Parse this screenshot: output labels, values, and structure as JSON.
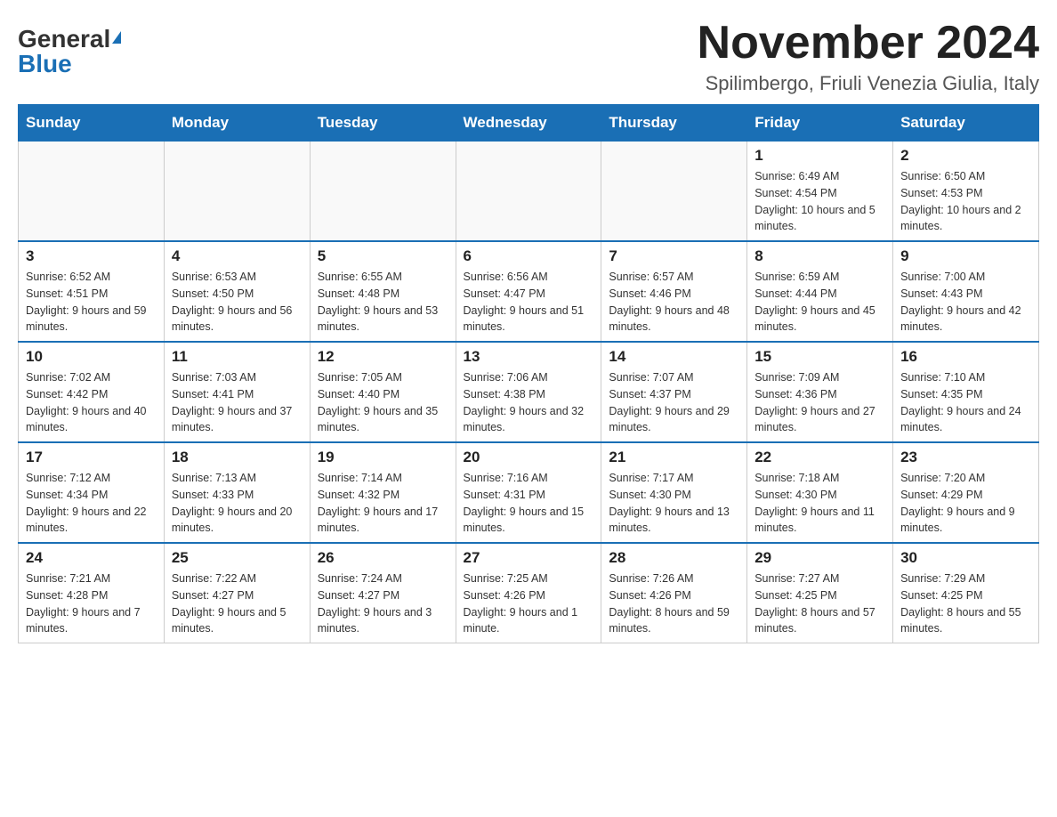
{
  "header": {
    "logo_general": "General",
    "logo_blue": "Blue",
    "month_title": "November 2024",
    "subtitle": "Spilimbergo, Friuli Venezia Giulia, Italy"
  },
  "days_of_week": [
    "Sunday",
    "Monday",
    "Tuesday",
    "Wednesday",
    "Thursday",
    "Friday",
    "Saturday"
  ],
  "weeks": [
    [
      {
        "day": "",
        "info": ""
      },
      {
        "day": "",
        "info": ""
      },
      {
        "day": "",
        "info": ""
      },
      {
        "day": "",
        "info": ""
      },
      {
        "day": "",
        "info": ""
      },
      {
        "day": "1",
        "info": "Sunrise: 6:49 AM\nSunset: 4:54 PM\nDaylight: 10 hours and 5 minutes."
      },
      {
        "day": "2",
        "info": "Sunrise: 6:50 AM\nSunset: 4:53 PM\nDaylight: 10 hours and 2 minutes."
      }
    ],
    [
      {
        "day": "3",
        "info": "Sunrise: 6:52 AM\nSunset: 4:51 PM\nDaylight: 9 hours and 59 minutes."
      },
      {
        "day": "4",
        "info": "Sunrise: 6:53 AM\nSunset: 4:50 PM\nDaylight: 9 hours and 56 minutes."
      },
      {
        "day": "5",
        "info": "Sunrise: 6:55 AM\nSunset: 4:48 PM\nDaylight: 9 hours and 53 minutes."
      },
      {
        "day": "6",
        "info": "Sunrise: 6:56 AM\nSunset: 4:47 PM\nDaylight: 9 hours and 51 minutes."
      },
      {
        "day": "7",
        "info": "Sunrise: 6:57 AM\nSunset: 4:46 PM\nDaylight: 9 hours and 48 minutes."
      },
      {
        "day": "8",
        "info": "Sunrise: 6:59 AM\nSunset: 4:44 PM\nDaylight: 9 hours and 45 minutes."
      },
      {
        "day": "9",
        "info": "Sunrise: 7:00 AM\nSunset: 4:43 PM\nDaylight: 9 hours and 42 minutes."
      }
    ],
    [
      {
        "day": "10",
        "info": "Sunrise: 7:02 AM\nSunset: 4:42 PM\nDaylight: 9 hours and 40 minutes."
      },
      {
        "day": "11",
        "info": "Sunrise: 7:03 AM\nSunset: 4:41 PM\nDaylight: 9 hours and 37 minutes."
      },
      {
        "day": "12",
        "info": "Sunrise: 7:05 AM\nSunset: 4:40 PM\nDaylight: 9 hours and 35 minutes."
      },
      {
        "day": "13",
        "info": "Sunrise: 7:06 AM\nSunset: 4:38 PM\nDaylight: 9 hours and 32 minutes."
      },
      {
        "day": "14",
        "info": "Sunrise: 7:07 AM\nSunset: 4:37 PM\nDaylight: 9 hours and 29 minutes."
      },
      {
        "day": "15",
        "info": "Sunrise: 7:09 AM\nSunset: 4:36 PM\nDaylight: 9 hours and 27 minutes."
      },
      {
        "day": "16",
        "info": "Sunrise: 7:10 AM\nSunset: 4:35 PM\nDaylight: 9 hours and 24 minutes."
      }
    ],
    [
      {
        "day": "17",
        "info": "Sunrise: 7:12 AM\nSunset: 4:34 PM\nDaylight: 9 hours and 22 minutes."
      },
      {
        "day": "18",
        "info": "Sunrise: 7:13 AM\nSunset: 4:33 PM\nDaylight: 9 hours and 20 minutes."
      },
      {
        "day": "19",
        "info": "Sunrise: 7:14 AM\nSunset: 4:32 PM\nDaylight: 9 hours and 17 minutes."
      },
      {
        "day": "20",
        "info": "Sunrise: 7:16 AM\nSunset: 4:31 PM\nDaylight: 9 hours and 15 minutes."
      },
      {
        "day": "21",
        "info": "Sunrise: 7:17 AM\nSunset: 4:30 PM\nDaylight: 9 hours and 13 minutes."
      },
      {
        "day": "22",
        "info": "Sunrise: 7:18 AM\nSunset: 4:30 PM\nDaylight: 9 hours and 11 minutes."
      },
      {
        "day": "23",
        "info": "Sunrise: 7:20 AM\nSunset: 4:29 PM\nDaylight: 9 hours and 9 minutes."
      }
    ],
    [
      {
        "day": "24",
        "info": "Sunrise: 7:21 AM\nSunset: 4:28 PM\nDaylight: 9 hours and 7 minutes."
      },
      {
        "day": "25",
        "info": "Sunrise: 7:22 AM\nSunset: 4:27 PM\nDaylight: 9 hours and 5 minutes."
      },
      {
        "day": "26",
        "info": "Sunrise: 7:24 AM\nSunset: 4:27 PM\nDaylight: 9 hours and 3 minutes."
      },
      {
        "day": "27",
        "info": "Sunrise: 7:25 AM\nSunset: 4:26 PM\nDaylight: 9 hours and 1 minute."
      },
      {
        "day": "28",
        "info": "Sunrise: 7:26 AM\nSunset: 4:26 PM\nDaylight: 8 hours and 59 minutes."
      },
      {
        "day": "29",
        "info": "Sunrise: 7:27 AM\nSunset: 4:25 PM\nDaylight: 8 hours and 57 minutes."
      },
      {
        "day": "30",
        "info": "Sunrise: 7:29 AM\nSunset: 4:25 PM\nDaylight: 8 hours and 55 minutes."
      }
    ]
  ]
}
